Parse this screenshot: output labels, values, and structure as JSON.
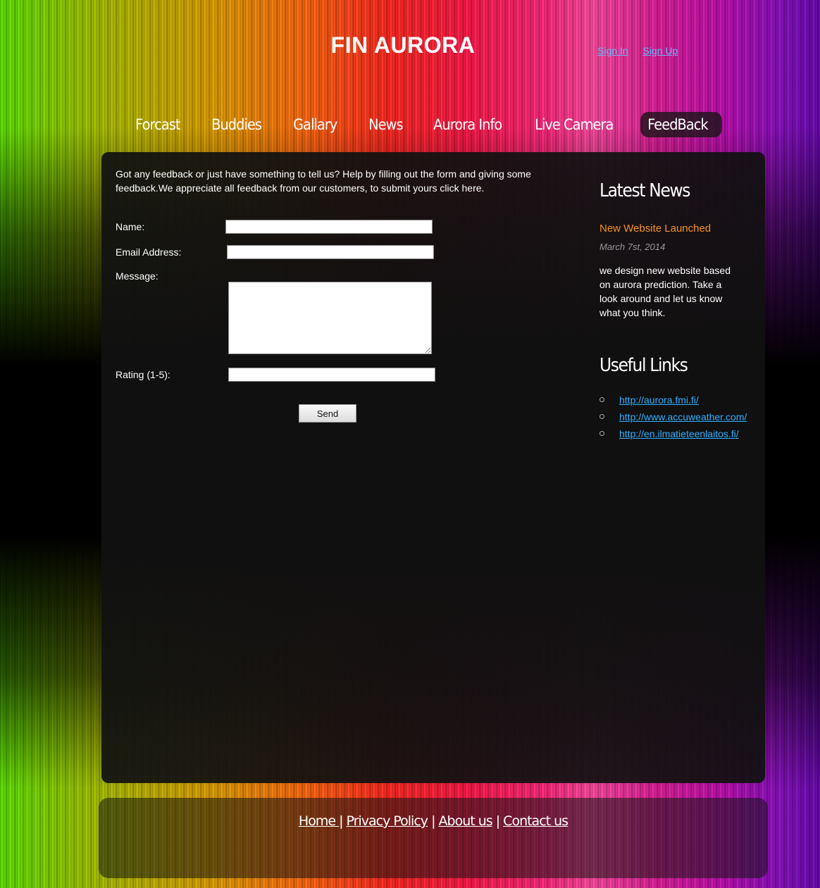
{
  "header": {
    "site_title": "FIN AURORA",
    "sign_in": "Sign In",
    "sign_up": "Sign Up"
  },
  "nav": {
    "items": [
      "Forcast",
      "Buddies",
      "Gallary",
      "News",
      "Aurora Info",
      "Live Camera",
      "FeedBack"
    ],
    "active": "FeedBack"
  },
  "main": {
    "intro": "Got any feedback or just have something to tell us? Help by filling out the form and giving some feedback.We appreciate all feedback from our customers, to submit yours click here.",
    "form": {
      "name_label": "Name:",
      "name_value": "",
      "email_label": "Email Address:",
      "email_value": "",
      "message_label": "Message:",
      "message_value": "",
      "rating_label": "Rating (1-5):",
      "rating_value": "",
      "send_label": "Send"
    }
  },
  "sidebar": {
    "latest_news_heading": "Latest News",
    "news_item": {
      "title": "New Website Launched",
      "date": "March 7st, 2014",
      "body": "we design new website based on aurora prediction. Take a look around and let us know what you think."
    },
    "useful_links_heading": "Useful Links",
    "links": [
      "http://aurora.fmi.fi/",
      "http://www.accuweather.com/",
      "http://en.ilmatieteenlaitos.fi/"
    ]
  },
  "footer": {
    "home": "Home ",
    "privacy": "Privacy Policy",
    "about": "About us",
    "contact": "Contact us",
    "separator": "|"
  },
  "colors": {
    "news_title": "#f7941d",
    "link": "#2fb0ff",
    "auth_link": "#6fb6ff",
    "panel": "#111111"
  }
}
